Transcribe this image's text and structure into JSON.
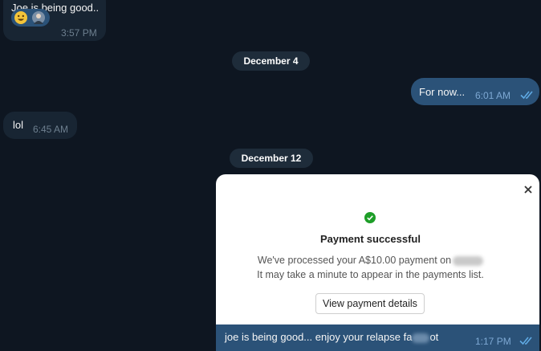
{
  "messages": [
    {
      "text": "Joe is being good..",
      "time": "3:57 PM"
    },
    {
      "text": "For now...",
      "time": "6:01 AM"
    },
    {
      "text": "lol",
      "time": "6:45 AM"
    },
    {
      "text": "joe is being good... enjoy your relapse fa",
      "text_end": "ot",
      "time": "1:17 PM"
    }
  ],
  "reactions": [
    "laughing-emoji",
    "user-avatar"
  ],
  "dates": [
    "December 4",
    "December 12"
  ],
  "payment": {
    "title": "Payment successful",
    "line1": "We've processed your A$10.00 payment on",
    "line2": "It may take a minute to appear in the payments list.",
    "button": "View payment details"
  },
  "colors": {
    "background": "#0e1621",
    "incoming_bubble": "#182533",
    "outgoing_bubble": "#2b5278",
    "success": "#1e9e28",
    "read_check": "#5fa9e3"
  }
}
